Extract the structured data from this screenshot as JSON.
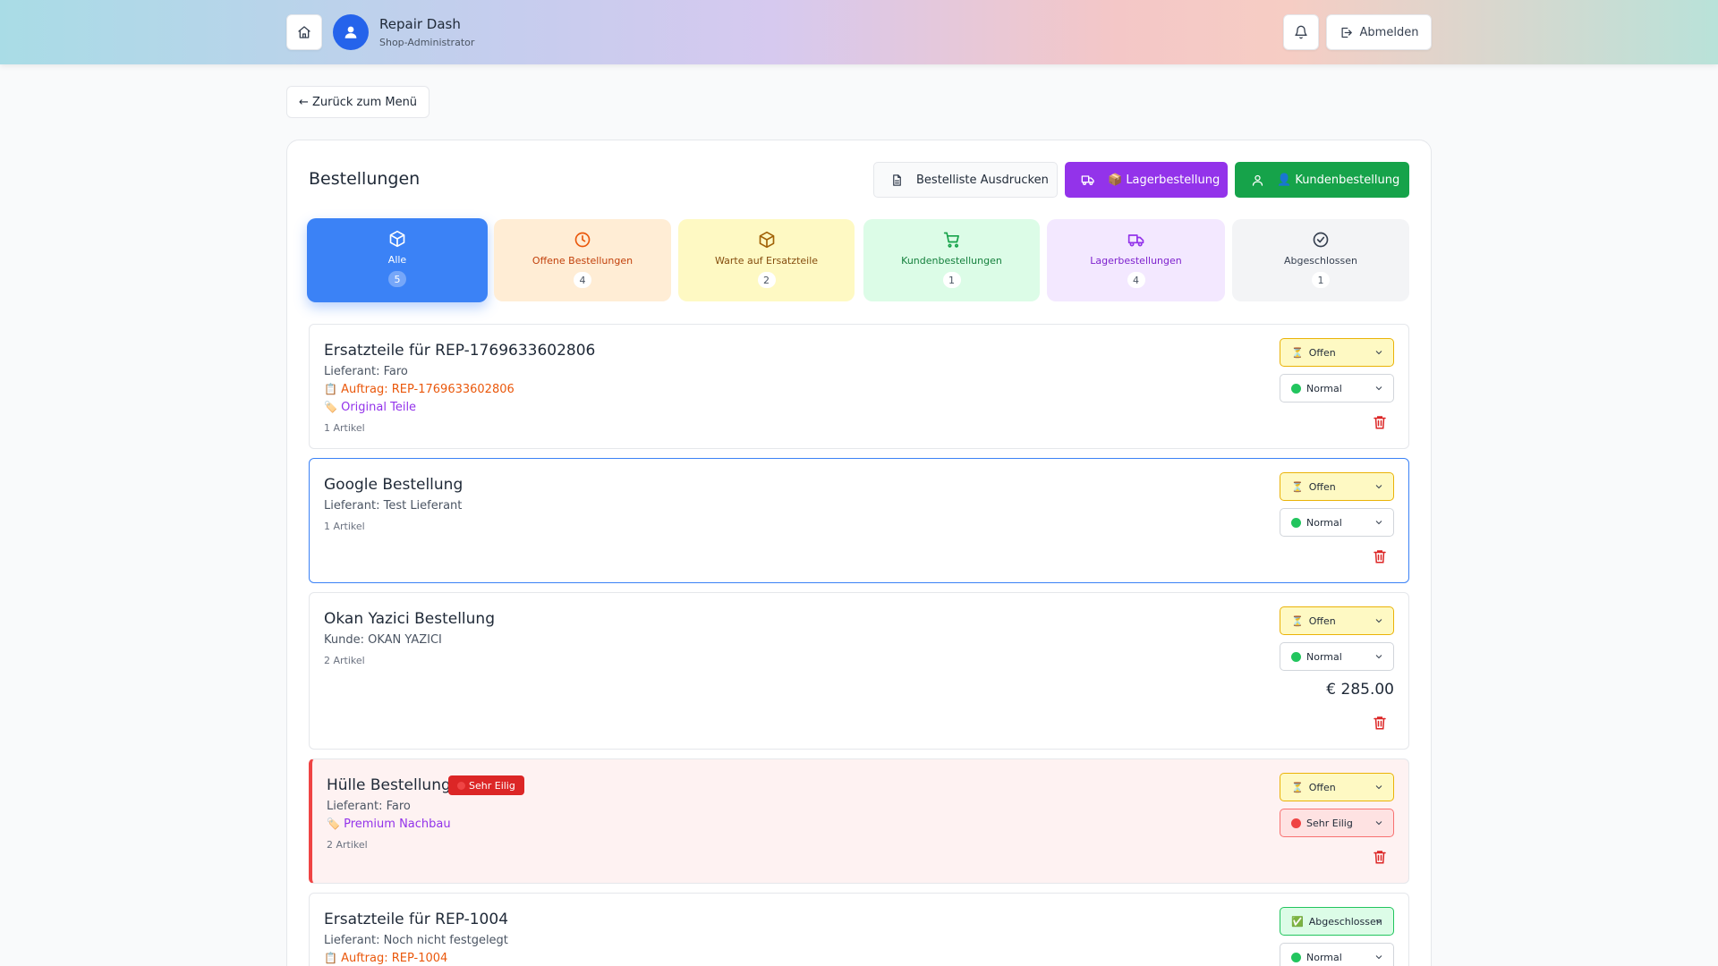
{
  "header": {
    "title": "Repair Dash",
    "subtitle": "Shop-Administrator",
    "logout_label": "Abmelden"
  },
  "nav": {
    "back_label": "← Zurück zum Menü"
  },
  "page": {
    "title": "Bestellungen",
    "print_label": "Bestelliste Ausdrucken",
    "lager_label": "📦 Lagerbestellung",
    "kunde_label": "👤 Kundenbestellung"
  },
  "tabs": [
    {
      "label": "Alle",
      "count": "5"
    },
    {
      "label": "Offene Bestellungen",
      "count": "4"
    },
    {
      "label": "Warte auf Ersatzteile",
      "count": "2"
    },
    {
      "label": "Kundenbestellungen",
      "count": "1"
    },
    {
      "label": "Lagerbestellungen",
      "count": "4"
    },
    {
      "label": "Abgeschlossen",
      "count": "1"
    }
  ],
  "orders": [
    {
      "title": "Ersatzteile für REP-1769633602806",
      "party": "Lieferant: Faro",
      "order_ref": "Auftrag: REP-1769633602806",
      "category": "Original Teile",
      "items": "1 Artikel",
      "status": "Offen",
      "priority": "Normal"
    },
    {
      "title": "Google Bestellung",
      "party": "Lieferant: Test Lieferant",
      "items": "1 Artikel",
      "status": "Offen",
      "priority": "Normal"
    },
    {
      "title": "Okan Yazici Bestellung",
      "party": "Kunde: OKAN YAZICI",
      "items": "2 Artikel",
      "status": "Offen",
      "priority": "Normal",
      "price": "€ 285.00"
    },
    {
      "title": "Hülle Bestellung",
      "badge": "Sehr Eilig",
      "party": "Lieferant: Faro",
      "category": "Premium Nachbau",
      "items": "2 Artikel",
      "status": "Offen",
      "priority": "Sehr Eilig"
    },
    {
      "title": "Ersatzteile für REP-1004",
      "party": "Lieferant: Noch nicht festgelegt",
      "order_ref": "Auftrag: REP-1004",
      "status": "Abgeschlossen",
      "priority": "Normal"
    }
  ],
  "icons": {
    "order_ref": "📋",
    "category": "🏷️",
    "status_open": "⏳",
    "status_done": "✅"
  },
  "colors": {
    "primary": "#3b82f6",
    "purple": "#9333ea",
    "green": "#16a34a",
    "danger": "#dc2626"
  }
}
